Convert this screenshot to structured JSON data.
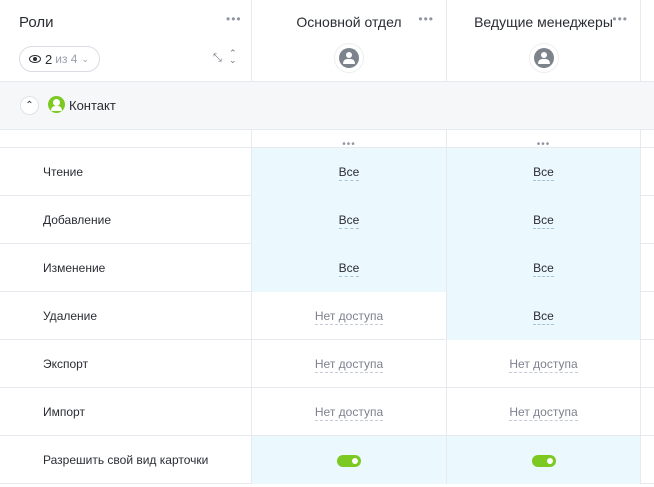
{
  "header": {
    "roles_title": "Роли",
    "visible_count": "2",
    "visible_of": "из 4",
    "columns": [
      {
        "title": "Основной отдел",
        "icon": "group-icon"
      },
      {
        "title": "Ведущие менеджеры",
        "icon": "group-icon"
      }
    ]
  },
  "section": {
    "title": "Контакт",
    "icon": "contact-icon",
    "accent": "#7cc922"
  },
  "rows": [
    {
      "label": "Чтение",
      "values": [
        "Все",
        "Все"
      ]
    },
    {
      "label": "Добавление",
      "values": [
        "Все",
        "Все"
      ]
    },
    {
      "label": "Изменение",
      "values": [
        "Все",
        "Все"
      ]
    },
    {
      "label": "Удаление",
      "values": [
        "Нет доступа",
        "Все"
      ]
    },
    {
      "label": "Экспорт",
      "values": [
        "Нет доступа",
        "Нет доступа"
      ]
    },
    {
      "label": "Импорт",
      "values": [
        "Нет доступа",
        "Нет доступа"
      ]
    },
    {
      "label": "Разрешить свой вид карточки",
      "values": [
        true,
        true
      ]
    }
  ],
  "colors": {
    "highlight": "#ebf8fd",
    "toggle_on": "#7cc922"
  }
}
